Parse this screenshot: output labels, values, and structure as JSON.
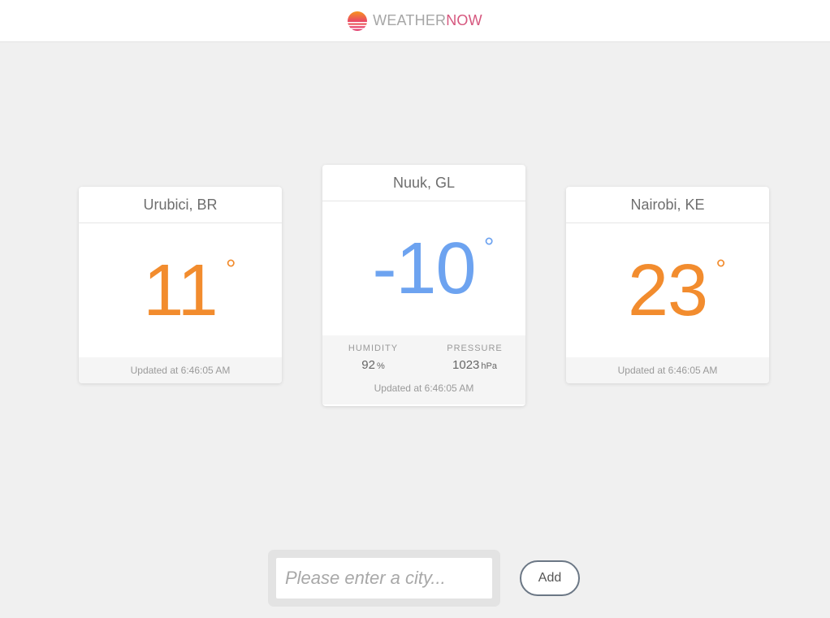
{
  "header": {
    "brand_part1": "WEATHER",
    "brand_part2": "NOW",
    "logo_icon": "sunset-icon",
    "brand_color_light": "#a6a6a6",
    "brand_color_accent": "#d6577e"
  },
  "cards": [
    {
      "city": "Urubici, BR",
      "temperature": "11",
      "degree_symbol": "°",
      "temp_color": "#f28c2e",
      "updated": "Updated at 6:46:05 AM"
    },
    {
      "city": "Nuuk, GL",
      "temperature": "-10",
      "degree_symbol": "°",
      "temp_color": "#6da3f0",
      "humidity_label": "HUMIDITY",
      "humidity_value": "92",
      "humidity_unit": "%",
      "pressure_label": "PRESSURE",
      "pressure_value": "1023",
      "pressure_unit": "hPa",
      "updated": "Updated at 6:46:05 AM"
    },
    {
      "city": "Nairobi, KE",
      "temperature": "23",
      "degree_symbol": "°",
      "temp_color": "#f28c2e",
      "updated": "Updated at 6:46:05 AM"
    }
  ],
  "search": {
    "value": "",
    "placeholder": "Please enter a city...",
    "add_label": "Add"
  }
}
